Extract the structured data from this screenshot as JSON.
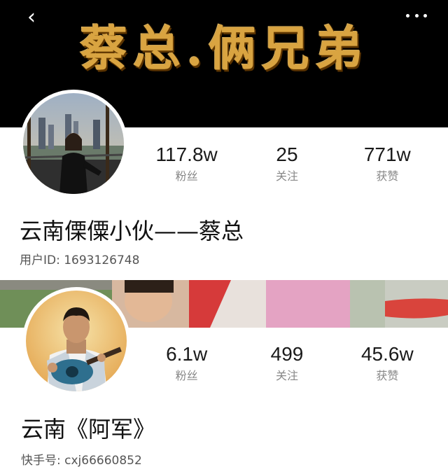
{
  "nav": {
    "back_icon": "chevron-left-icon",
    "more_icon": "more-dots-icon"
  },
  "profile1": {
    "banner_title": "蔡总.俩兄弟",
    "stats": [
      {
        "value": "117.8w",
        "label": "粉丝"
      },
      {
        "value": "25",
        "label": "关注"
      },
      {
        "value": "771w",
        "label": "获赞"
      }
    ],
    "name": "云南傈僳小伙——蔡总",
    "user_id": "用户ID: 1693126748"
  },
  "profile2": {
    "stats": [
      {
        "value": "6.1w",
        "label": "粉丝"
      },
      {
        "value": "499",
        "label": "关注"
      },
      {
        "value": "45.6w",
        "label": "获赞"
      }
    ],
    "name": "云南《阿军》",
    "user_id": "快手号: cxj66660852"
  },
  "colors": {
    "banner_bg": "#000000",
    "banner_title": "#d9a441",
    "stat_label": "#888888"
  }
}
